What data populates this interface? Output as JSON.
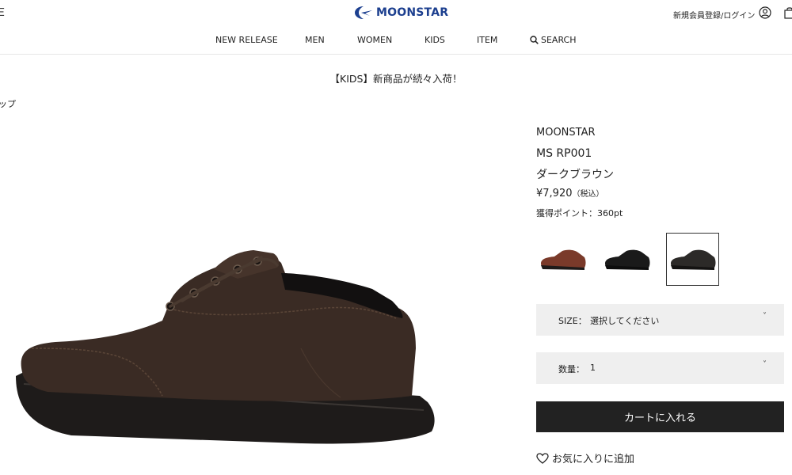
{
  "header": {
    "menu_edge_glyph": "Ξ",
    "logo_text": "MOONSTAR",
    "login_label": "新規会員登録/ログイン",
    "icons": [
      "account-icon",
      "shopping-bag-icon",
      "search-icon",
      "heart-icon",
      "chevron-down-icon"
    ]
  },
  "nav": {
    "items": [
      "NEW RELEASE",
      "MEN",
      "WOMEN",
      "KIDS",
      "ITEM"
    ],
    "search_label": "SEARCH"
  },
  "announcement": "【KIDS】新商品が続々入荷！",
  "breadcrumb": "ップ",
  "product": {
    "brand": "MOONSTAR",
    "model": "MS RP001",
    "color_name": "ダークブラウン",
    "price": "¥7,920",
    "price_tax_note": "（税込）",
    "points": "獲得ポイント：360pt",
    "swatch_selected_index": 2,
    "swatches": [
      {
        "color": "#7a3a2a"
      },
      {
        "color": "#1a1a1a"
      },
      {
        "color": "#2c2a28"
      }
    ]
  },
  "size_select": {
    "label": "SIZE：",
    "value": "選択してください"
  },
  "quantity_select": {
    "label": "数量：",
    "value": "1"
  },
  "cart_button_label": "カートに入れる",
  "favorite_label": "お気に入りに追加",
  "colors": {
    "brand_blue": "#1c3f8f",
    "button_dark": "#222222",
    "select_bg": "#efefef",
    "shoe_brown": "#3a2b24"
  }
}
